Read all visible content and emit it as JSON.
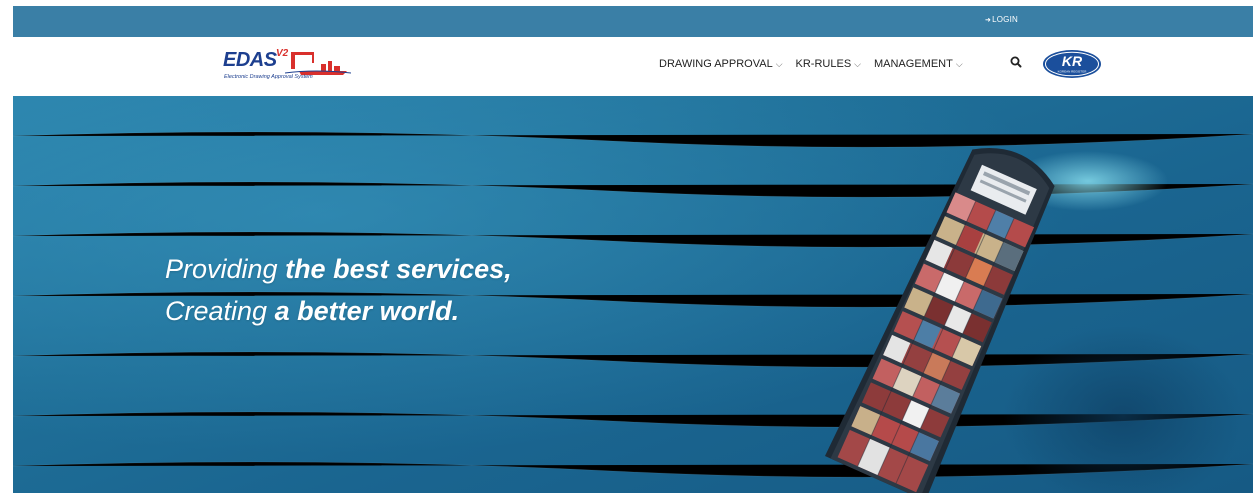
{
  "topbar": {
    "login_label": "LOGIN",
    "login_icon": "sign-in-icon",
    "bg_color": "#3a7fa6"
  },
  "logo": {
    "name": "EDAS",
    "version": "V2",
    "subtitle": "Electronic Drawing Approval System"
  },
  "nav": {
    "items": [
      {
        "label": "DRAWING APPROVAL"
      },
      {
        "label": "KR-RULES"
      },
      {
        "label": "MANAGEMENT"
      }
    ],
    "search_icon": "search-icon"
  },
  "partner_logo": {
    "text": "KR",
    "subtext": "KOREAN REGISTER"
  },
  "hero": {
    "line1_pre": "Providing ",
    "line1_bold": "the best services,",
    "line2_pre": "Creating ",
    "line2_bold": "a better world."
  }
}
